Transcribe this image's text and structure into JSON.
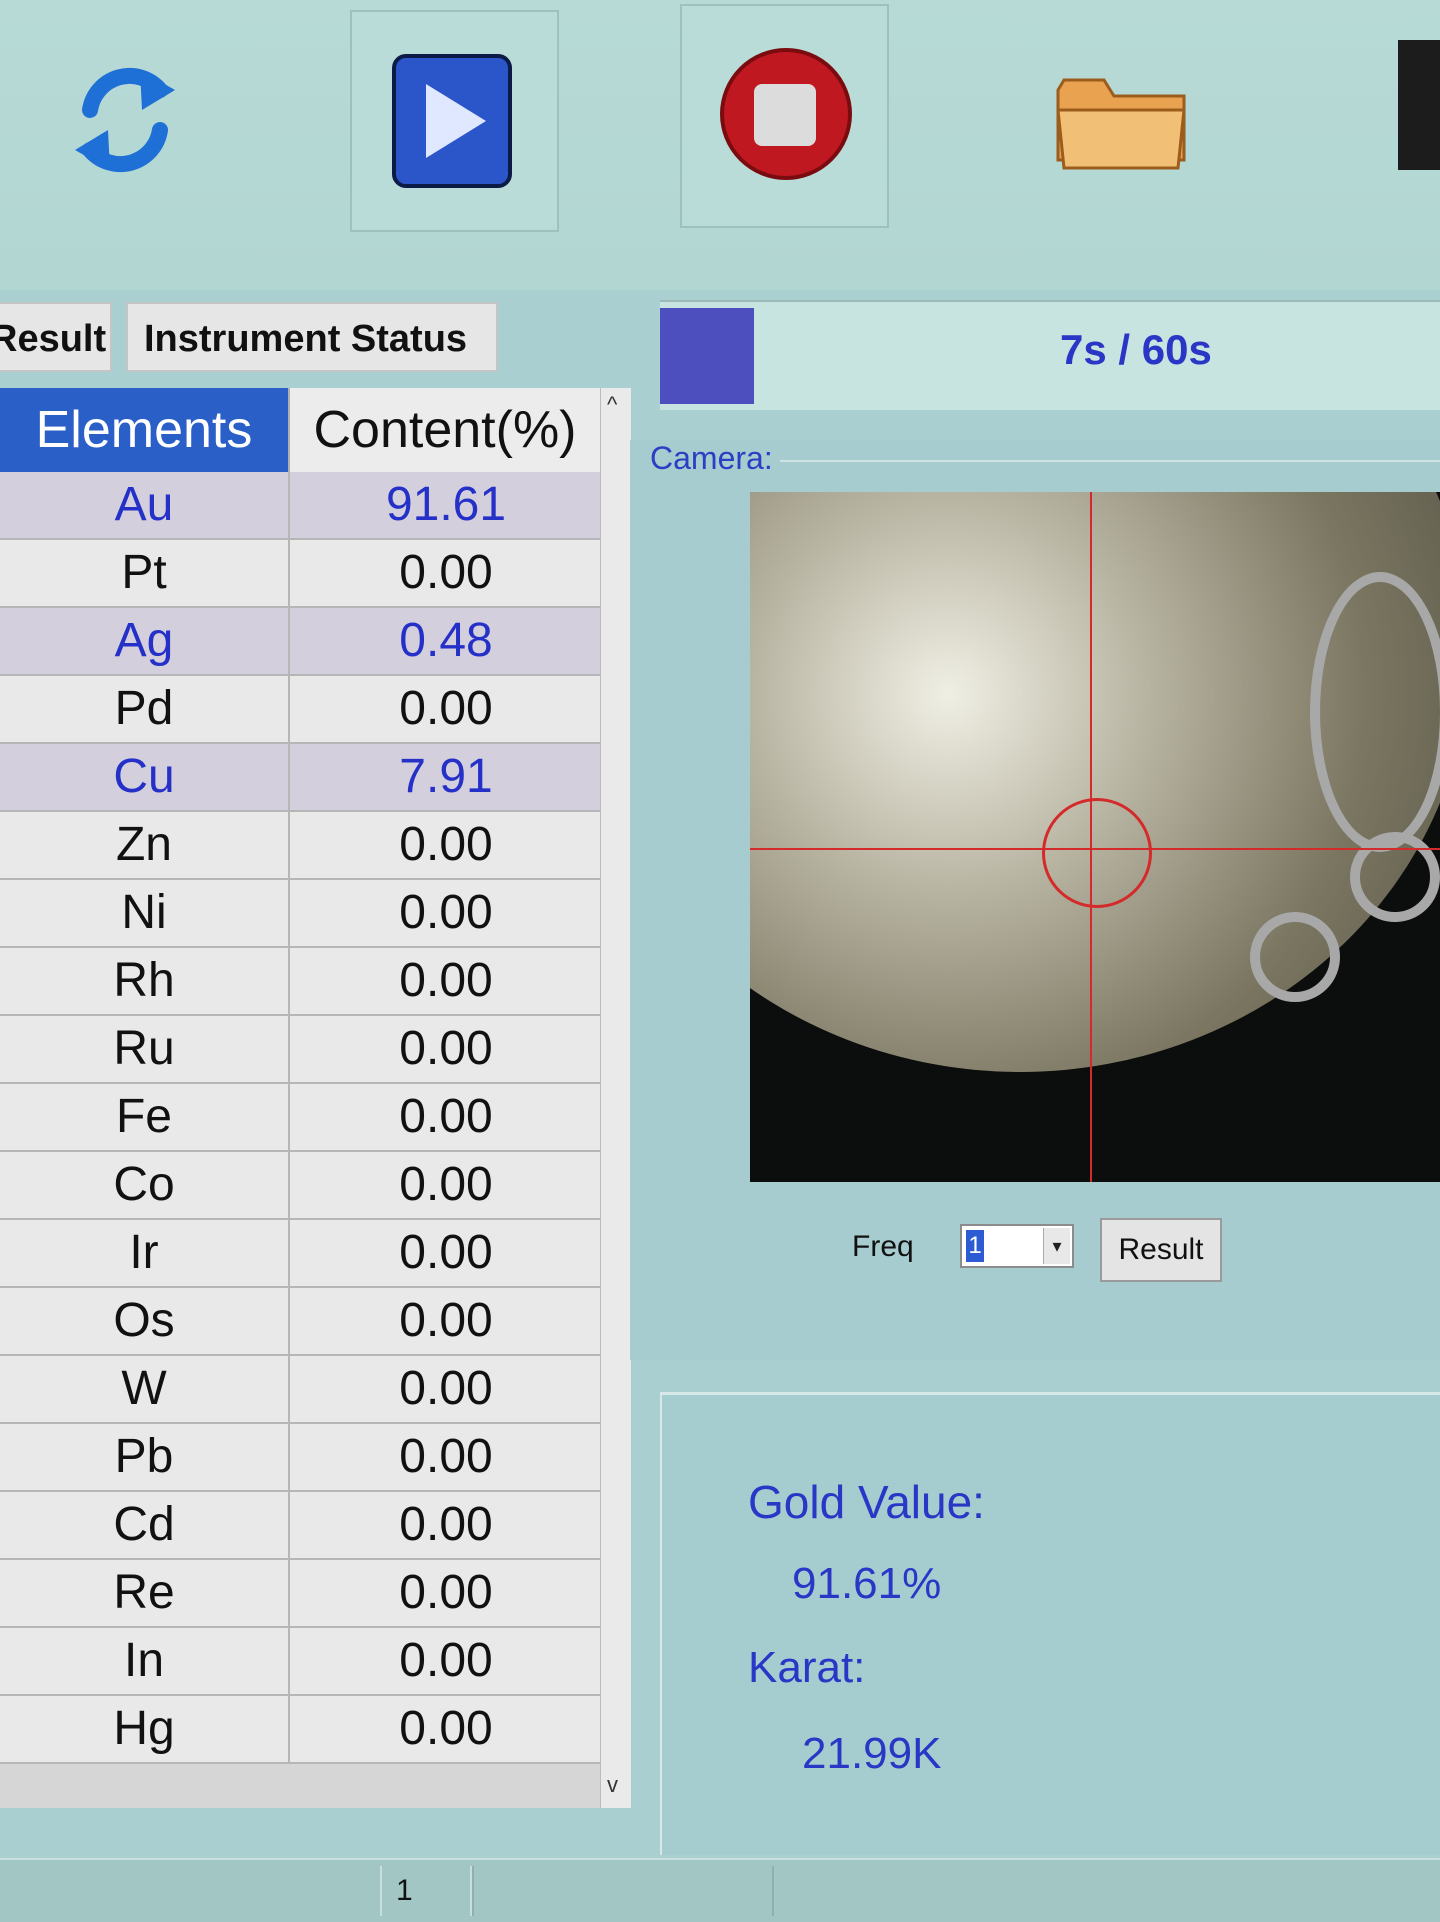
{
  "toolbar": {
    "icons": [
      "refresh-icon",
      "play-icon",
      "stop-icon",
      "folder-icon",
      "save-icon"
    ]
  },
  "tabs": [
    {
      "label": "Result"
    },
    {
      "label": "Instrument Status"
    }
  ],
  "table": {
    "headers": {
      "elements": "Elements",
      "content": "Content(%)"
    },
    "rows": [
      {
        "el": "Au",
        "val": "91.61",
        "highlight": true
      },
      {
        "el": "Pt",
        "val": "0.00",
        "highlight": false
      },
      {
        "el": "Ag",
        "val": "0.48",
        "highlight": true
      },
      {
        "el": "Pd",
        "val": "0.00",
        "highlight": false
      },
      {
        "el": "Cu",
        "val": "7.91",
        "highlight": true
      },
      {
        "el": "Zn",
        "val": "0.00",
        "highlight": false
      },
      {
        "el": "Ni",
        "val": "0.00",
        "highlight": false
      },
      {
        "el": "Rh",
        "val": "0.00",
        "highlight": false
      },
      {
        "el": "Ru",
        "val": "0.00",
        "highlight": false
      },
      {
        "el": "Fe",
        "val": "0.00",
        "highlight": false
      },
      {
        "el": "Co",
        "val": "0.00",
        "highlight": false
      },
      {
        "el": "Ir",
        "val": "0.00",
        "highlight": false
      },
      {
        "el": "Os",
        "val": "0.00",
        "highlight": false
      },
      {
        "el": "W",
        "val": "0.00",
        "highlight": false
      },
      {
        "el": "Pb",
        "val": "0.00",
        "highlight": false
      },
      {
        "el": "Cd",
        "val": "0.00",
        "highlight": false
      },
      {
        "el": "Re",
        "val": "0.00",
        "highlight": false
      },
      {
        "el": "In",
        "val": "0.00",
        "highlight": false
      },
      {
        "el": "Hg",
        "val": "0.00",
        "highlight": false
      }
    ]
  },
  "progress": {
    "time": "7s / 60s",
    "fraction": 0.12
  },
  "camera": {
    "label": "Camera:",
    "freq_label": "Freq",
    "freq_value": "1",
    "result_button": "Result"
  },
  "result": {
    "gold_label": "Gold Value:",
    "gold_value": "91.61%",
    "karat_label": "Karat:",
    "karat_value": "21.99K"
  },
  "statusbar": {
    "page": "1"
  },
  "colors": {
    "accent_blue": "#2a36c5",
    "header_blue": "#2a5fc8",
    "crosshair": "#d42a2a"
  }
}
